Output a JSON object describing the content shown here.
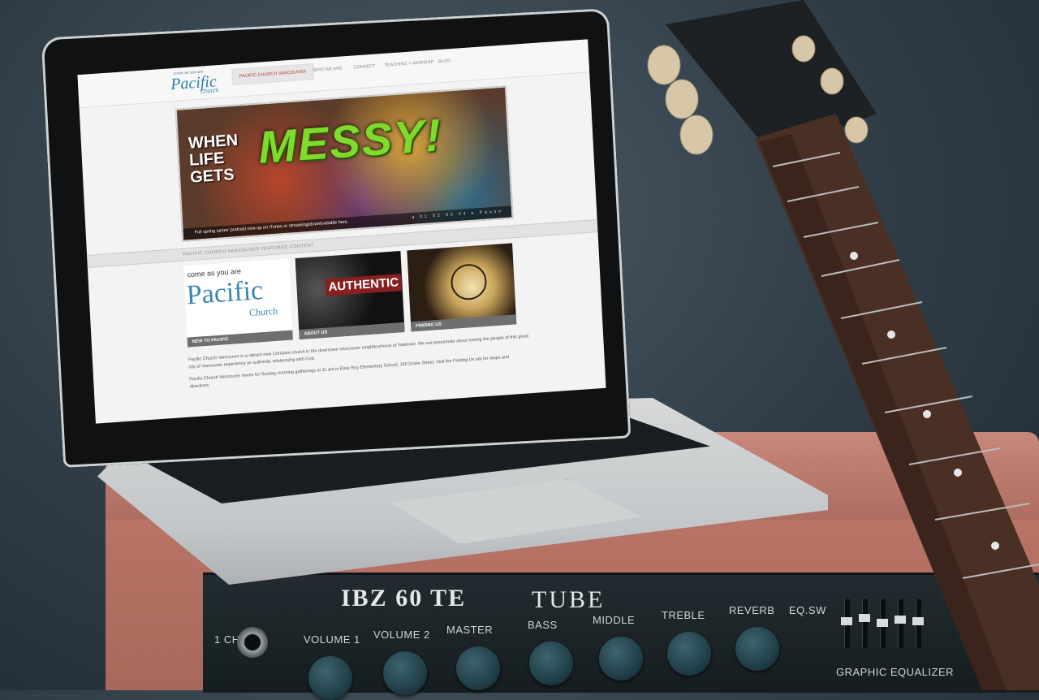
{
  "site": {
    "logo_tagline": "come as you are",
    "logo": "Pacific",
    "logo_sub": "Church",
    "nav": [
      {
        "label": "PACIFIC CHURCH VANCOUVER",
        "active": true
      },
      {
        "label": "WHO WE ARE"
      },
      {
        "label": "CONNECT"
      },
      {
        "label": "TEACHING + WORSHIP"
      },
      {
        "label": "BLOG"
      }
    ],
    "hero": {
      "when": "WHEN",
      "life": "LIFE",
      "gets": "GETS",
      "messy": "MESSY!",
      "caption": "Full spring series' podcast now up on iTunes or streaming/downloadable here.",
      "controls": "◂ 01 02 03 04 ▸ Pause"
    },
    "featured_label": "PACIFIC CHURCH VANCOUVER FEATURED CONTENT",
    "tiles": [
      {
        "caption": "NEW TO PACIFIC",
        "small": "come as you are",
        "big": "Pacific",
        "sub": "Church"
      },
      {
        "caption": "ABOUT US",
        "big": "AUTHENTIC"
      },
      {
        "caption": "FINDING US"
      }
    ],
    "paragraph1": "Pacific Church Vancouver is a vibrant new Christian church in the downtown Vancouver neighbourhood of Yaletown. We are passionate about seeing the people of this great city of Vancouver experience an authentic relationship with God.",
    "paragraph2": "Pacific Church Vancouver meets for Sunday morning gatherings at 11 am in Elsie Roy Elementary School, 150 Drake Street. Visit the Finding Us tab for maps and directions."
  },
  "amp": {
    "brand": "IBZ 60 TE",
    "tube": "TUBE",
    "labels": [
      "VOLUME 1",
      "VOLUME 2",
      "MASTER",
      "BASS",
      "MIDDLE",
      "TREBLE",
      "REVERB"
    ],
    "channel": "1 CH",
    "eq_label": "EQ.SW",
    "eq_footer": "GRAPHIC EQUALIZER"
  }
}
